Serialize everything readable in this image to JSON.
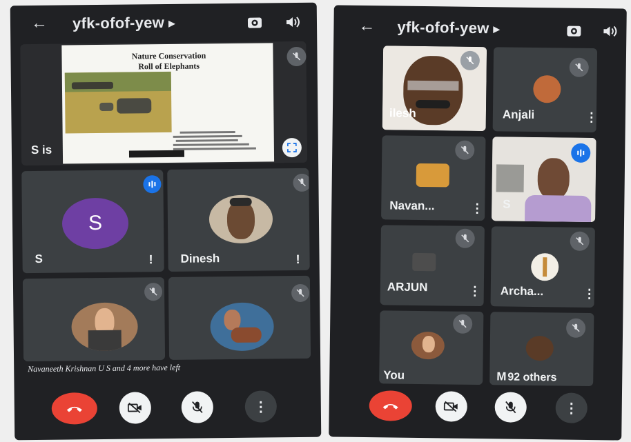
{
  "left": {
    "meeting_code": "yfk-ofof-yew",
    "presentation": {
      "presenter_label": "S is",
      "slide_title_line1": "Nature Conservation",
      "slide_title_line2": "Roll of Elephants"
    },
    "tiles": [
      {
        "name": "S",
        "avatar_letter": "S",
        "avatar_color": "#6e3fa3",
        "state": "speaking"
      },
      {
        "name": "Dinesh",
        "state": "muted"
      },
      {
        "name": "",
        "state": "muted"
      },
      {
        "name": "",
        "state": "muted"
      }
    ],
    "toast": "Navaneeth Krishnan U S and 4 more have left"
  },
  "right": {
    "meeting_code": "yfk-ofof-yew",
    "tiles": [
      {
        "name": "ilesh",
        "state": "muted"
      },
      {
        "name": "Anjali",
        "state": "muted"
      },
      {
        "name": "Navan...",
        "state": "muted"
      },
      {
        "name": "S",
        "state": "speaking"
      },
      {
        "name": "ARJUN",
        "state": "muted"
      },
      {
        "name": "Archa...",
        "state": "muted"
      },
      {
        "name": "You",
        "state": "muted"
      },
      {
        "name": "M",
        "state": "muted"
      }
    ],
    "others_label": "92 others"
  },
  "colors": {
    "end_call": "#ea4335",
    "speaking_badge": "#1a73e8",
    "tile_bg": "#3c4043",
    "background": "#202124"
  },
  "icons": [
    "back-arrow-icon",
    "switch-camera-icon",
    "speaker-icon",
    "mic-off-icon",
    "audio-level-icon",
    "fullscreen-icon",
    "end-call-icon",
    "camera-off-icon",
    "more-options-icon"
  ]
}
